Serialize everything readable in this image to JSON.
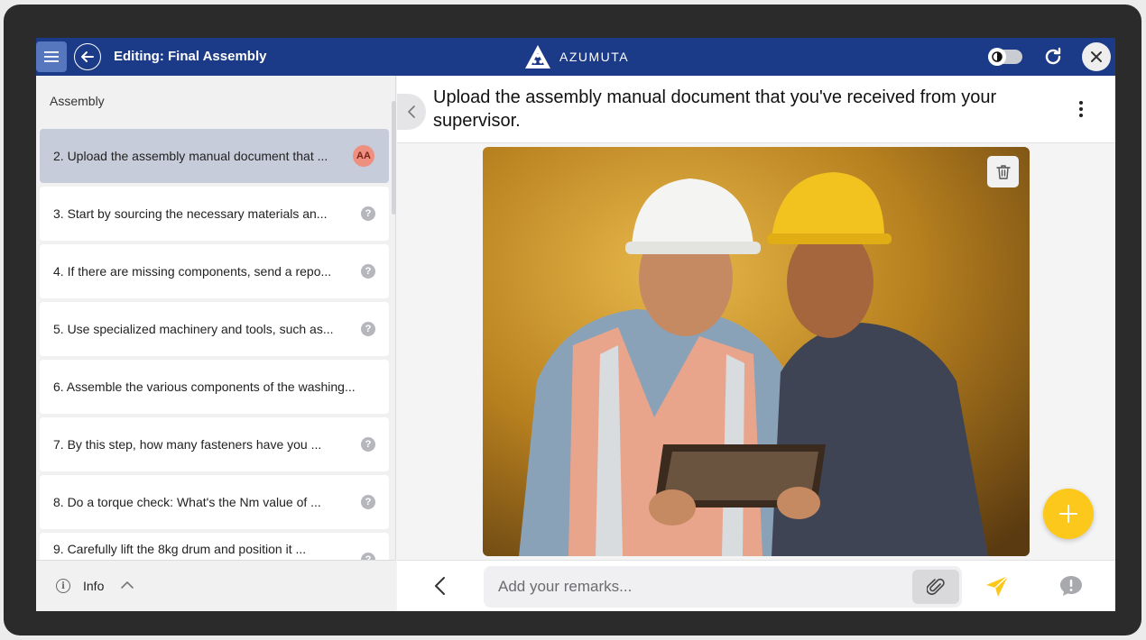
{
  "header": {
    "title": "Editing: Final Assembly",
    "brand": "AZUMUTA"
  },
  "sidebar": {
    "heading": "Assembly",
    "steps": [
      {
        "label": "2. Upload the assembly manual document that ...",
        "assignee": "AA",
        "active": true
      },
      {
        "label": "3. Start by sourcing the necessary materials an..."
      },
      {
        "label": "4. If there are missing components, send a repo..."
      },
      {
        "label": "5. Use specialized machinery and tools, such as..."
      },
      {
        "label": "6. Assemble the various components of the washing..."
      },
      {
        "label": "7. By this step, how many fasteners have you ..."
      },
      {
        "label": "8. Do a torque check: What's the Nm value of ..."
      },
      {
        "label": "9. Carefully lift the 8kg drum and position it ..."
      }
    ],
    "help_glyph": "?",
    "footer": {
      "info_label": "Info",
      "info_glyph": "i"
    }
  },
  "main": {
    "step_title": "Upload the assembly manual document that you've received from your supervisor."
  },
  "bottom": {
    "remarks_placeholder": "Add your remarks..."
  },
  "colors": {
    "header_bg": "#1b3a87",
    "active_step": "#c7ccdb",
    "avatar": "#ee8f80",
    "accent_yellow": "#fcc81c"
  },
  "icons": [
    "menu-icon",
    "arrow-left-icon",
    "azumuta-logo-icon",
    "toggle-icon",
    "refresh-icon",
    "close-icon",
    "help-icon",
    "info-icon",
    "chevron-up-icon",
    "chevron-left-icon",
    "more-vertical-icon",
    "trash-icon",
    "plus-icon",
    "paperclip-icon",
    "send-icon",
    "comment-alert-icon"
  ]
}
